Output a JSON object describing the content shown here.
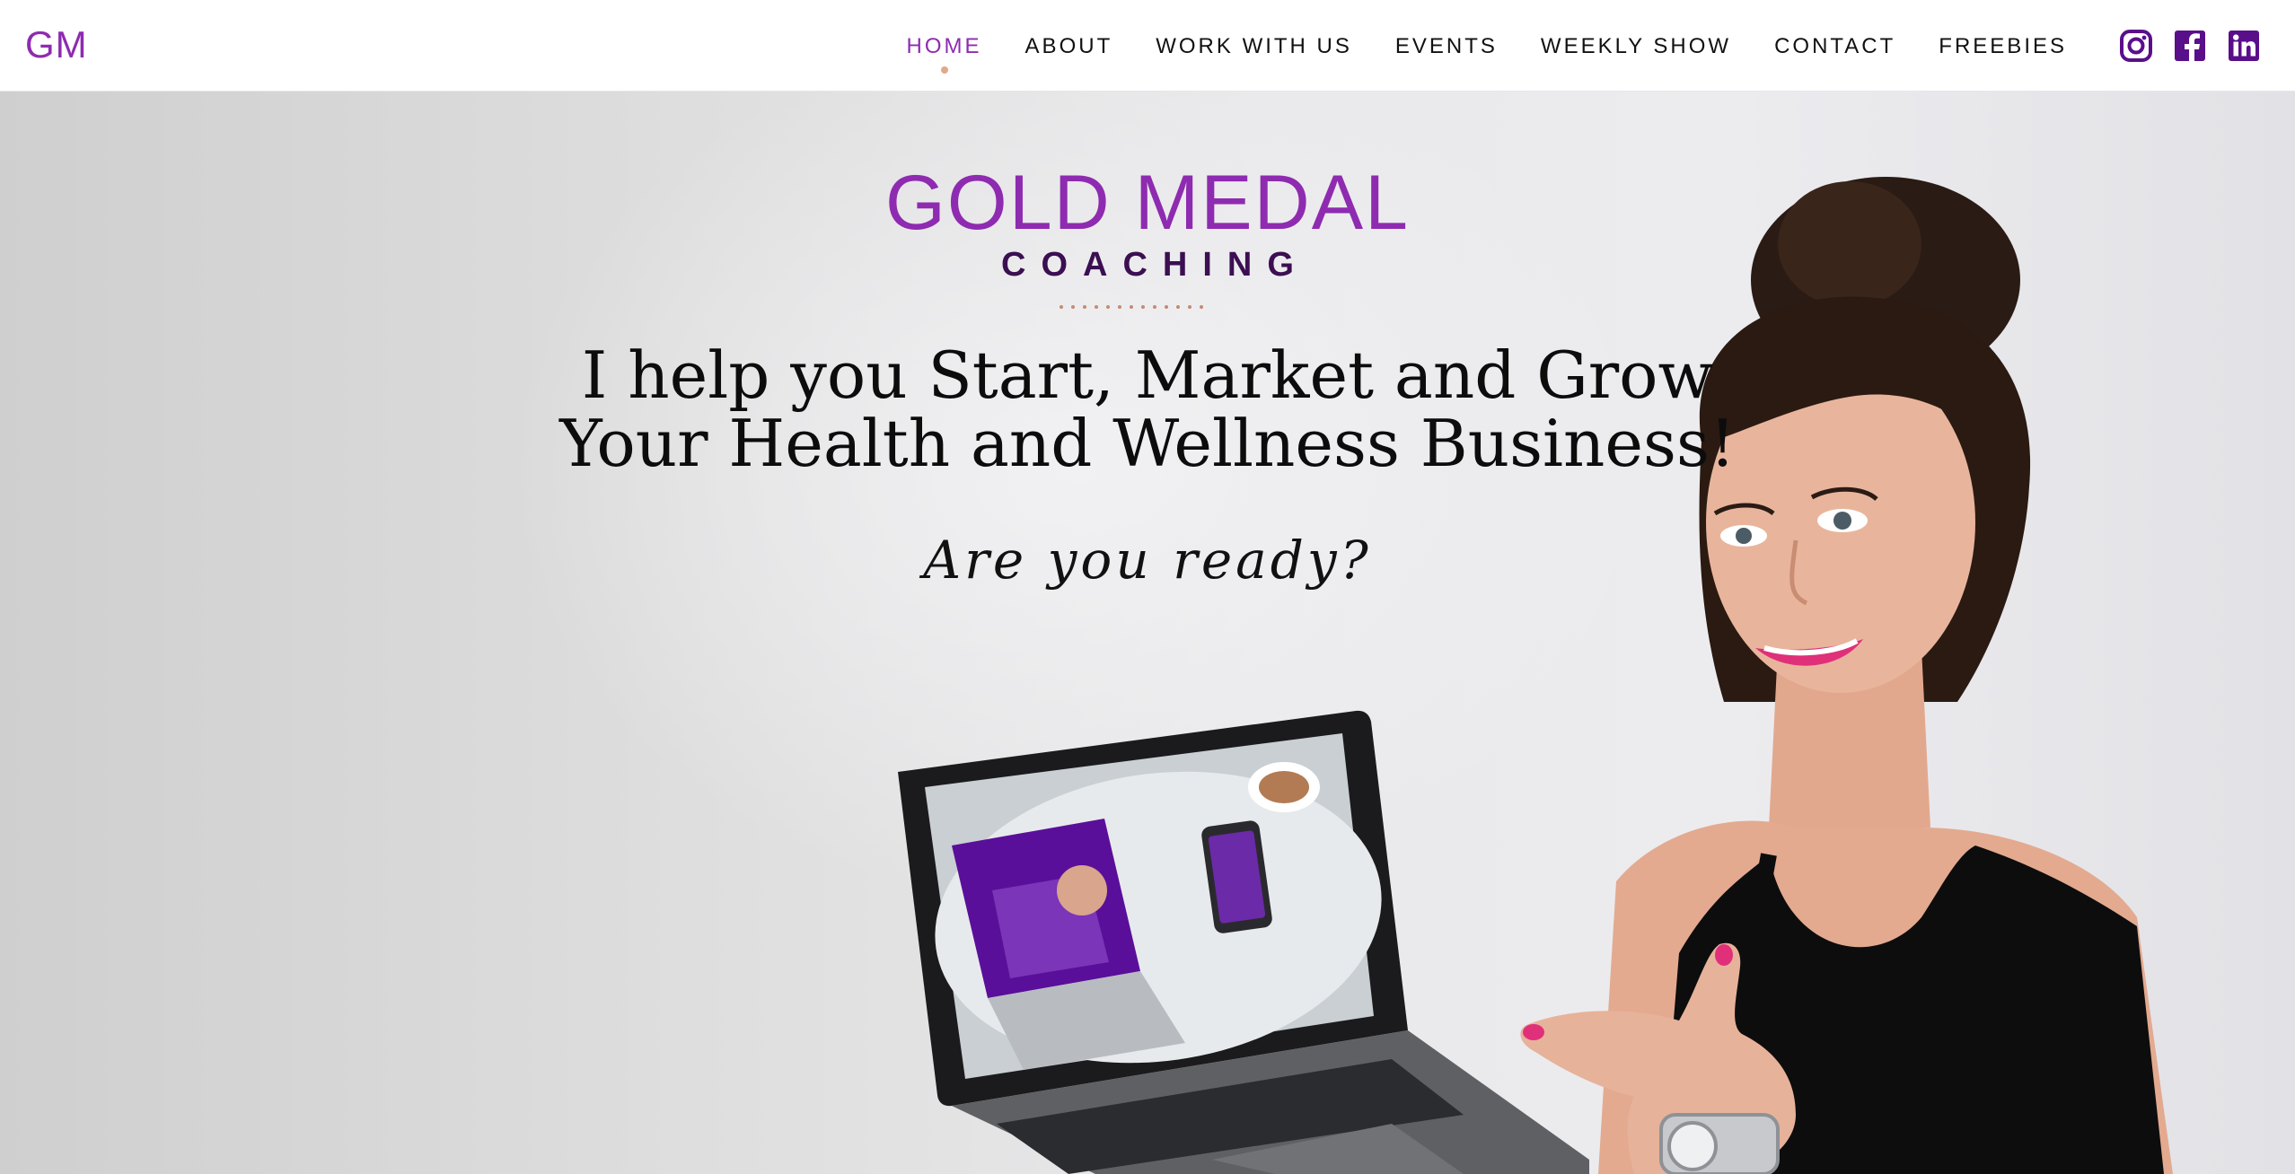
{
  "header": {
    "logo": "GM",
    "nav": [
      {
        "label": "HOME",
        "active": true
      },
      {
        "label": "ABOUT",
        "active": false
      },
      {
        "label": "WORK WITH US",
        "active": false
      },
      {
        "label": "EVENTS",
        "active": false
      },
      {
        "label": "WEEKLY SHOW",
        "active": false
      },
      {
        "label": "CONTACT",
        "active": false
      },
      {
        "label": "FREEBIES",
        "active": false
      }
    ],
    "social": [
      "instagram-icon",
      "facebook-icon",
      "linkedin-icon"
    ]
  },
  "hero": {
    "brand_title": "GOLD MEDAL",
    "brand_subtitle": "COACHING",
    "headline_line1": "I help you Start, Market and Grow",
    "headline_line2": "Your Health and Wellness Business!",
    "tagline": "Are you ready?"
  },
  "colors": {
    "brand_purple": "#8e2bb0",
    "dark_purple": "#3b0f52",
    "accent_dot": "#e0a98c",
    "icon_purple": "#5a0f8a"
  }
}
